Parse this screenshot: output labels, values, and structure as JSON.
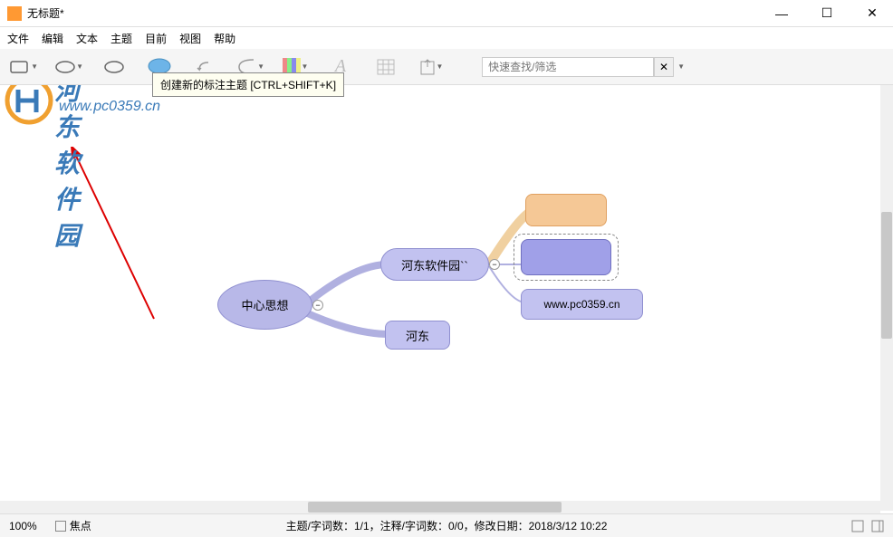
{
  "titlebar": {
    "title": "无标题*"
  },
  "menubar": {
    "items": [
      "文件",
      "编辑",
      "文本",
      "主题",
      "目前",
      "视图",
      "帮助"
    ]
  },
  "toolbar": {
    "search_placeholder": "快速查找/筛选"
  },
  "tooltip": {
    "text": "创建新的标注主题 [CTRL+SHIFT+K]"
  },
  "watermark": {
    "line1": "河东软件园",
    "line2": "www.pc0359.cn"
  },
  "mindmap": {
    "center": "中心思想",
    "main": "河东软件园``",
    "child1": "河东",
    "url": "www.pc0359.cn"
  },
  "statusbar": {
    "zoom": "100%",
    "focus_label": "焦点",
    "status": "主题/字词数：1/1，注释/字词数：0/0，修改日期：2018/3/12 10:22"
  }
}
